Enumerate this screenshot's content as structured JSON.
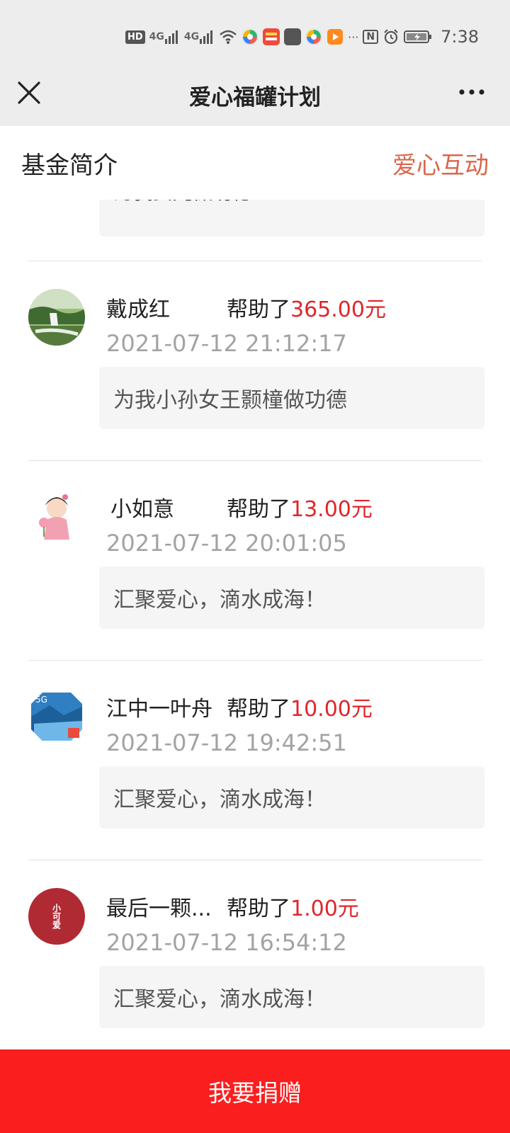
{
  "status_bar": {
    "time": "7:38",
    "hd_label": "HD",
    "net1": "4G",
    "net2": "4G",
    "dots": "···",
    "nfc_label": "N"
  },
  "nav": {
    "title": "爱心福罐计划"
  },
  "tabs": {
    "left": "基金简介",
    "right": "爱心互动"
  },
  "partial_message": "为我女儿做功德",
  "donations": [
    {
      "name": "戴成红",
      "helped_text": "帮助了",
      "amount": "365.00元",
      "time": "2021-07-12 21:12:17",
      "message": "为我小孙女王颢橦做功德"
    },
    {
      "name": " 小如意",
      "helped_text": "帮助了",
      "amount": "13.00元",
      "time": "2021-07-12 20:01:05",
      "message": "汇聚爱心，滴水成海！"
    },
    {
      "name": "江中一叶舟",
      "helped_text": "帮助了",
      "amount": "10.00元",
      "time": "2021-07-12 19:42:51",
      "message": "汇聚爱心，滴水成海！"
    },
    {
      "name": "最后一颗...",
      "helped_text": "帮助了",
      "amount": "1.00元",
      "time": "2021-07-12 16:54:12",
      "message": "汇聚爱心，滴水成海！",
      "avatar_text": "小可爱"
    }
  ],
  "donate_button": "我要捐赠",
  "colors": {
    "accent_tab": "#d9664a",
    "amount": "#e0262a",
    "button": "#fb1e1e"
  }
}
